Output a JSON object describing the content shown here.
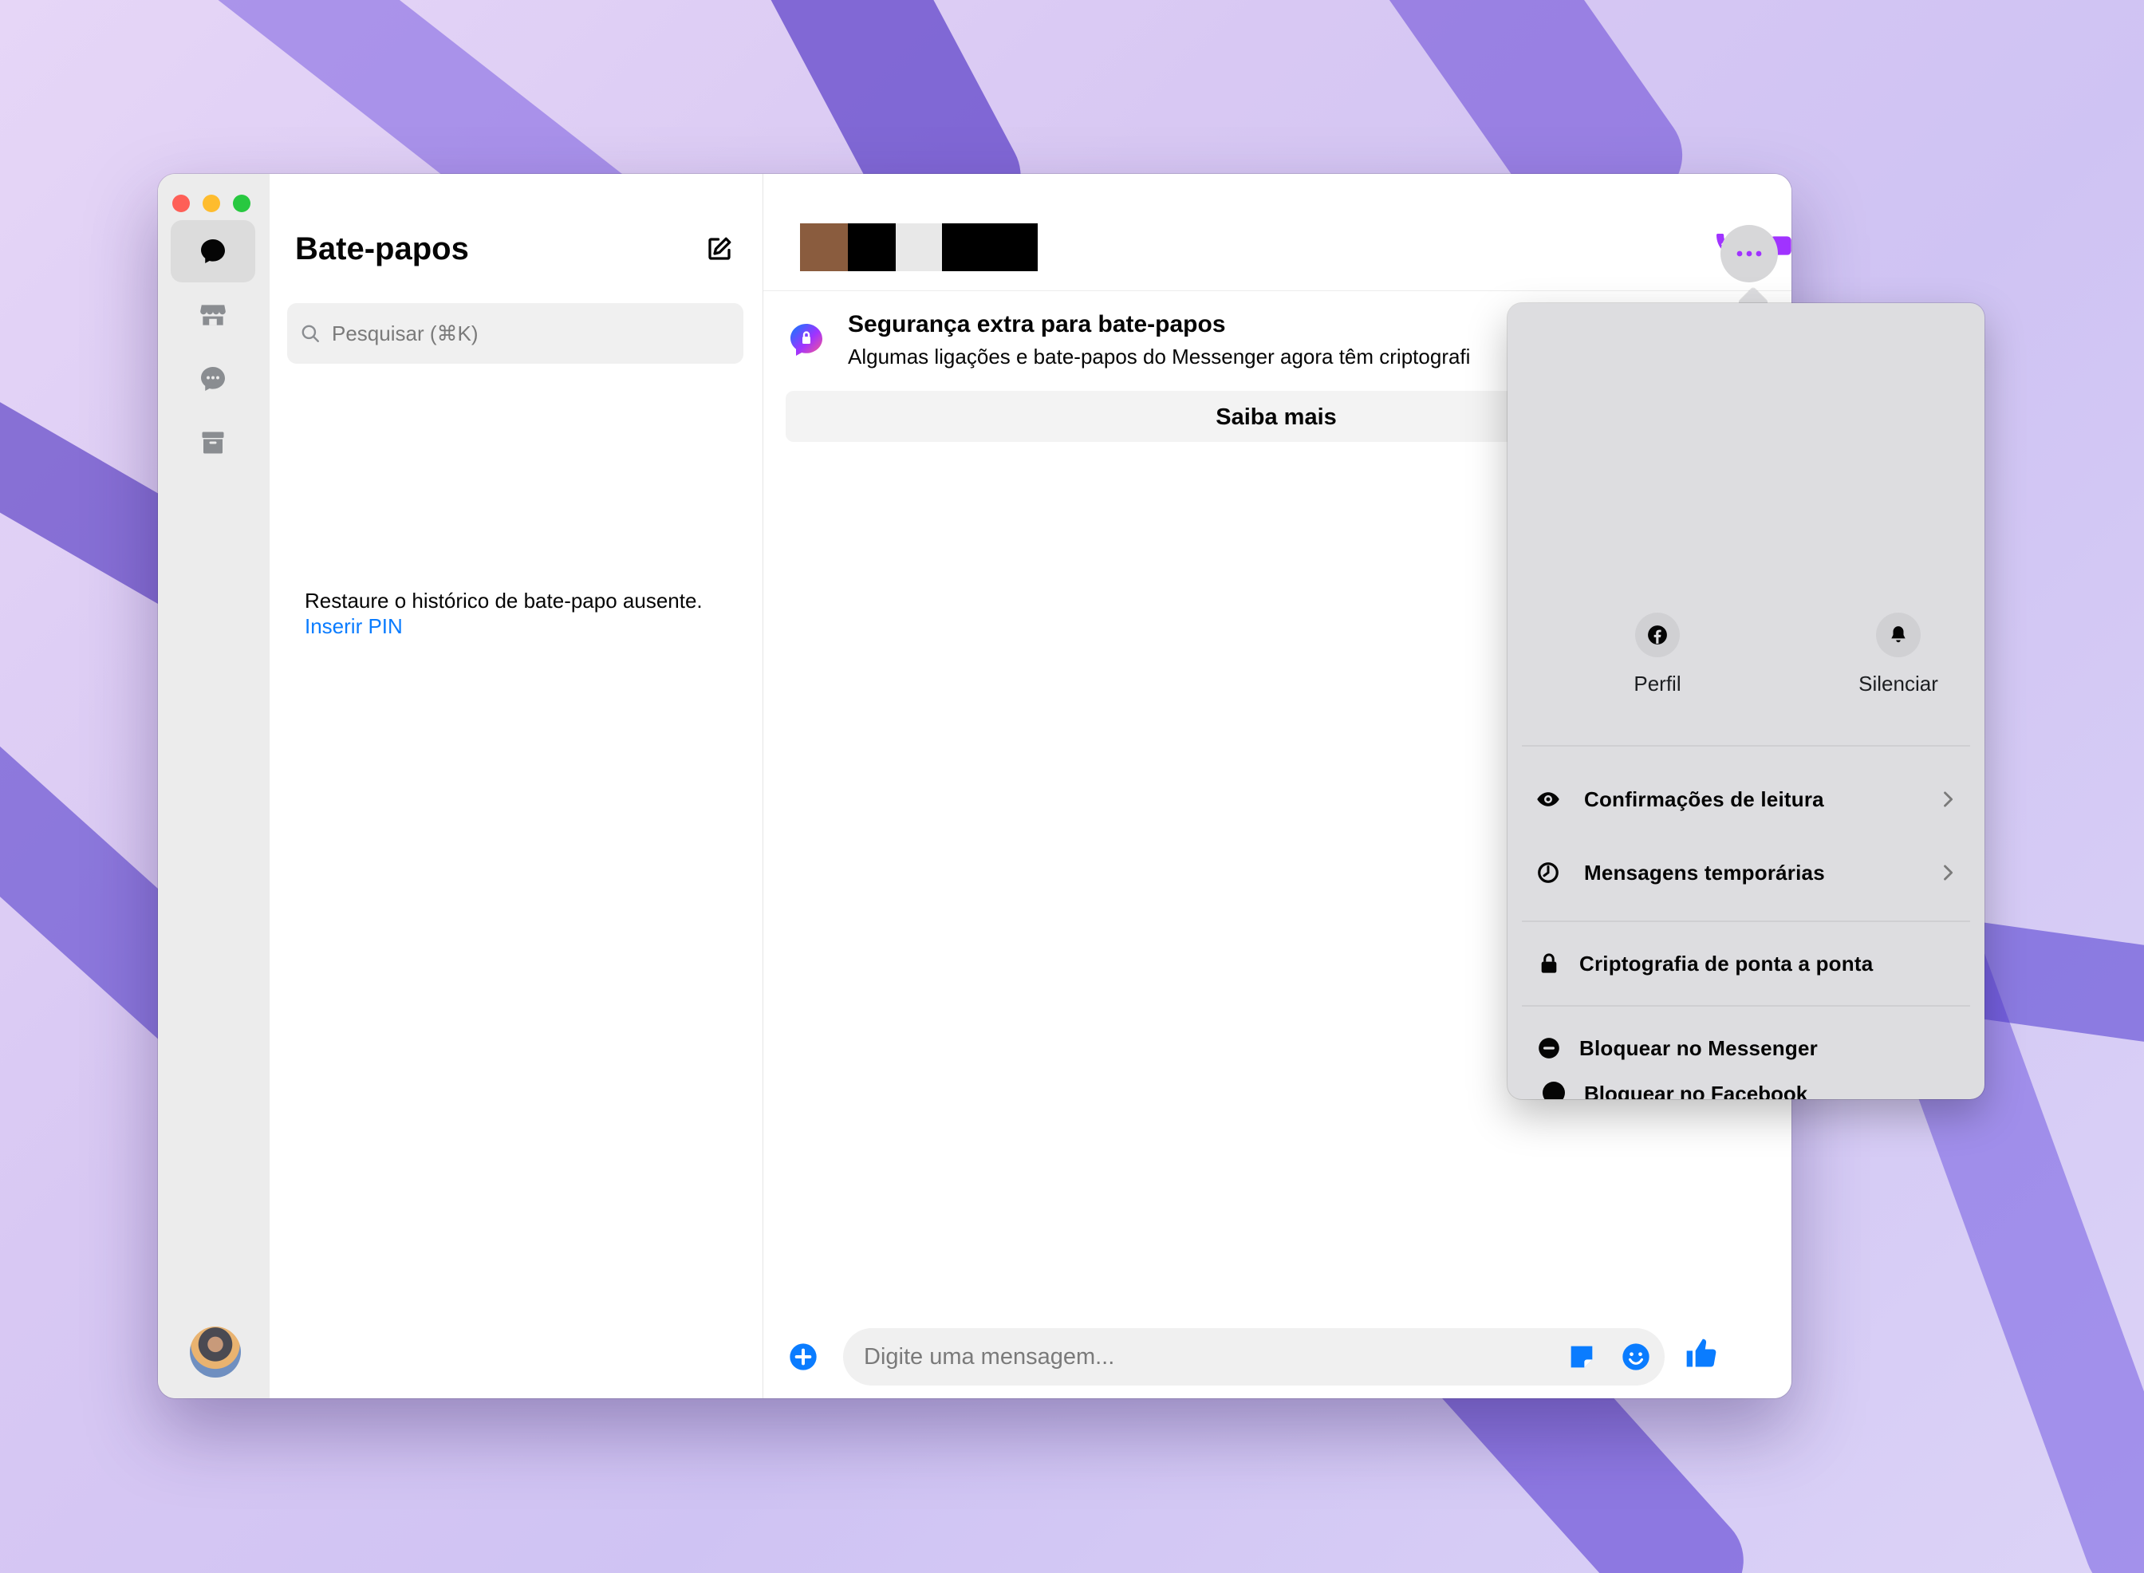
{
  "sidebar": {
    "title": "Bate-papos",
    "search_placeholder": "Pesquisar (⌘K)",
    "restore_text": "Restaure o histórico de bate-papo ausente.",
    "restore_link": "Inserir PIN"
  },
  "rail": {
    "icons": [
      "chat-bubble-icon",
      "store-icon",
      "message-request-icon",
      "archive-icon"
    ]
  },
  "conversation": {
    "security_title": "Segurança extra para bate-papos",
    "security_subtitle": "Algumas ligações e bate-papos do Messenger agora têm criptografi",
    "learn_more": "Saiba mais",
    "composer_placeholder": "Digite uma mensagem..."
  },
  "menu": {
    "actions": [
      {
        "label": "Perfil",
        "icon": "facebook-icon"
      },
      {
        "label": "Silenciar",
        "icon": "bell-icon"
      }
    ],
    "read_receipts": "Confirmações de leitura",
    "disappearing": "Mensagens temporárias",
    "encryption": "Criptografia de ponta a ponta",
    "block_messenger": "Bloquear no Messenger",
    "block_facebook": "Bloquear no Facebook"
  },
  "colors": {
    "accent_purple": "#a033ff",
    "link_blue": "#0a7cff",
    "messenger_blue": "#0a7cff"
  }
}
